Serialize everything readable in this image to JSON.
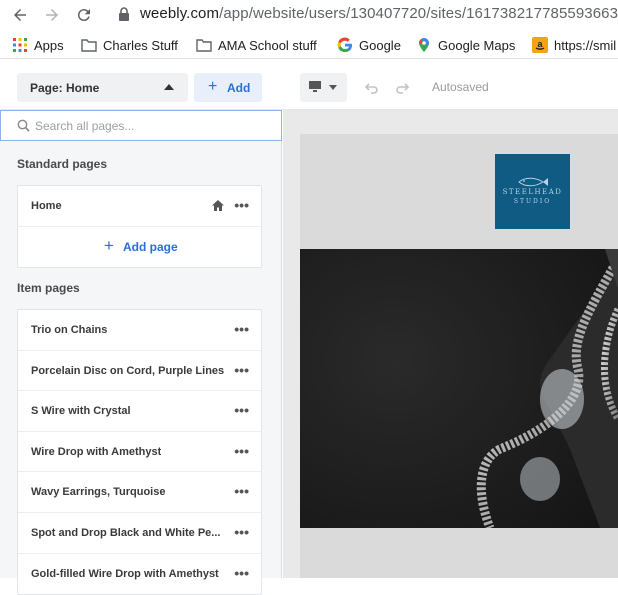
{
  "browser": {
    "url_host": "weebly.com",
    "url_path": "/app/website/users/130407720/sites/161738217785593663/",
    "bookmarks": [
      {
        "label": "Apps",
        "icon": "apps-grid-icon"
      },
      {
        "label": "Charles Stuff",
        "icon": "folder-icon"
      },
      {
        "label": "AMA School stuff",
        "icon": "folder-icon"
      },
      {
        "label": "Google",
        "icon": "google-icon"
      },
      {
        "label": "Google Maps",
        "icon": "google-maps-icon"
      },
      {
        "label": "https://smil",
        "icon": "amazon-icon"
      }
    ]
  },
  "toolbar": {
    "page_select_label": "Page: Home",
    "add_label": "Add",
    "status": "Autosaved"
  },
  "sidebar": {
    "search_placeholder": "Search all pages...",
    "standard_title": "Standard pages",
    "standard_pages": [
      {
        "name": "Home"
      }
    ],
    "add_page_label": "Add page",
    "item_title": "Item pages",
    "item_pages": [
      {
        "name": "Trio on Chains"
      },
      {
        "name": "Porcelain Disc on Cord, Purple Lines"
      },
      {
        "name": "S Wire with Crystal"
      },
      {
        "name": "Wire Drop with Amethyst"
      },
      {
        "name": "Wavy Earrings, Turquoise"
      },
      {
        "name": "Spot and Drop Black and White Pe..."
      },
      {
        "name": "Gold-filled Wire Drop with Amethyst"
      }
    ]
  },
  "canvas": {
    "logo_line1": "STEELHEAD",
    "logo_line2": "STUDIO"
  },
  "colors": {
    "accent": "#2a6fd6",
    "logo_bg": "#0f5b84"
  }
}
